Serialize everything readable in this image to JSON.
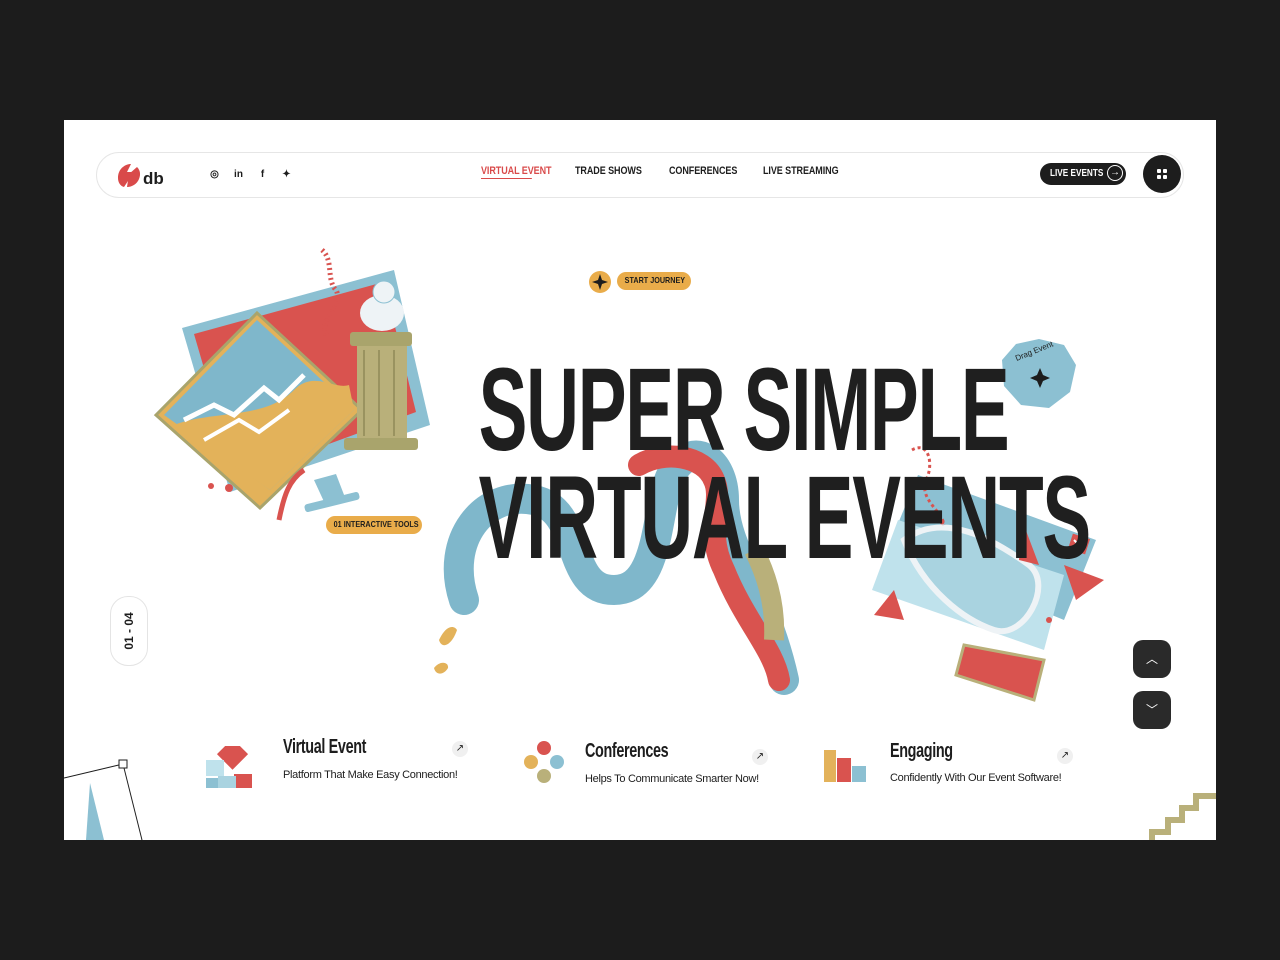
{
  "colors": {
    "background": "#1c1c1c",
    "accent_red": "#d94a4a",
    "accent_yellow": "#e9ac4a",
    "accent_blue": "#7fb7cb",
    "accent_olive": "#b9b07a",
    "dark": "#1d1d1d"
  },
  "nav": {
    "logo_text": "db",
    "socials": [
      {
        "icon": "instagram-icon",
        "glyph": "◎"
      },
      {
        "icon": "linkedin-icon",
        "glyph": "in"
      },
      {
        "icon": "facebook-icon",
        "glyph": "f"
      },
      {
        "icon": "twitter-icon",
        "glyph": "✦"
      }
    ],
    "menu": [
      {
        "label": "VIRTUAL EVENT",
        "active": true
      },
      {
        "label": "TRADE SHOWS",
        "active": false
      },
      {
        "label": "CONFERENCES",
        "active": false
      },
      {
        "label": "LIVE STREAMING",
        "active": false
      }
    ],
    "live_button": "LIVE EVENTS"
  },
  "hero": {
    "start_badge": "START JOURNEY",
    "headline_line1": "SUPER SIMPLE",
    "headline_line2": "VIRTUAL EVENTS",
    "tools_badge": "01 INTERACTIVE TOOLS",
    "drag_label": "Drag Event",
    "counter": "01 - 04"
  },
  "features": [
    {
      "title": "Virtual Event",
      "subtitle": "Platform That Make Easy Connection!",
      "icon": "virtual-event-icon"
    },
    {
      "title": "Conferences",
      "subtitle": "Helps To Communicate Smarter Now!",
      "icon": "conferences-icon"
    },
    {
      "title": "Engaging",
      "subtitle": "Confidently With Our Event Software!",
      "icon": "engaging-icon"
    }
  ]
}
